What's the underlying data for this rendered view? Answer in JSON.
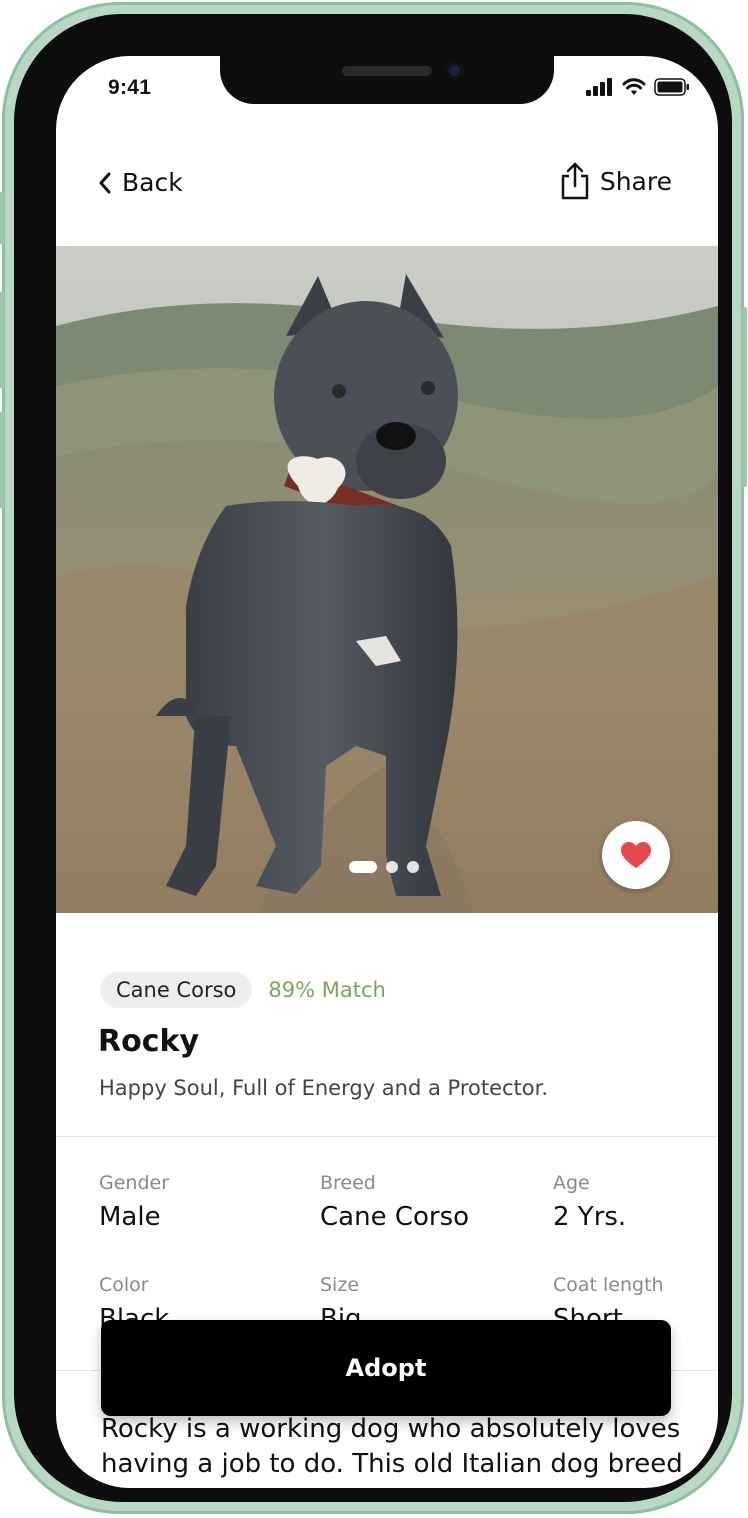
{
  "status_bar": {
    "time": "9:41"
  },
  "nav": {
    "back_label": "Back",
    "share_label": "Share"
  },
  "carousel": {
    "page_count": 3,
    "active_index": 0,
    "favorited": true
  },
  "pet": {
    "breed_tag": "Cane Corso",
    "match": "89% Match",
    "name": "Rocky",
    "tagline": "Happy Soul, Full of Energy and a Protector."
  },
  "attributes": [
    {
      "label": "Gender",
      "value": "Male"
    },
    {
      "label": "Breed",
      "value": "Cane Corso"
    },
    {
      "label": "Age",
      "value": "2 Yrs."
    },
    {
      "label": "Color",
      "value": "Black"
    },
    {
      "label": "Size",
      "value": "Big"
    },
    {
      "label": "Coat length",
      "value": "Short"
    }
  ],
  "adopt_button": {
    "label": "Adopt"
  },
  "description": "Rocky is a working dog who absolutely loves having a job to do. This old Italian dog breed",
  "colors": {
    "match_green": "#7aa55e",
    "heart_red": "#e5494f",
    "device_frame": "#b9d8c4",
    "button_black": "#000000"
  }
}
